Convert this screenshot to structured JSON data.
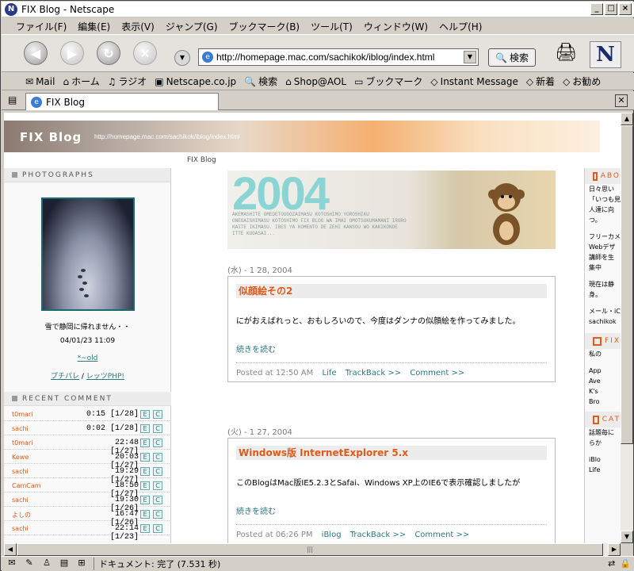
{
  "window": {
    "title": "FIX Blog - Netscape"
  },
  "menu": [
    "ファイル(F)",
    "編集(E)",
    "表示(V)",
    "ジャンプ(G)",
    "ブックマーク(B)",
    "ツール(T)",
    "ウィンドウ(W)",
    "ヘルプ(H)"
  ],
  "toolbar": {
    "url": "http://homepage.mac.com/sachikok/iblog/index.html",
    "search_label": "検索"
  },
  "personal_bar": [
    "Mail",
    "ホーム",
    "ラジオ",
    "Netscape.co.jp",
    "検索",
    "Shop@AOL",
    "ブックマーク",
    "Instant Message",
    "新着",
    "お勧め"
  ],
  "tab": {
    "label": "FIX Blog"
  },
  "status": {
    "text": "ドキュメント: 完了 (7.531 秒)"
  },
  "page": {
    "banner_title": "FIX Blog",
    "banner_url": "http://homepage.mac.com/sachikok/iblog/index.html",
    "crumb": "FIX Blog",
    "photos_header": "PHOTOGRAPHS",
    "photo_caption": "雪で静岡に帰れません・・",
    "photo_date": "04/01/23 11:09",
    "photo_link": "*~old",
    "links": [
      "プチパレ",
      "レッツPHP!"
    ],
    "recent_header": "RECENT COMMENT",
    "recent_comments": [
      {
        "name": "t0mari",
        "time": "0:15 [1/28]"
      },
      {
        "name": "sachi",
        "time": "0:02 [1/28]"
      },
      {
        "name": "t0mari",
        "time": "22:48 [1/27]"
      },
      {
        "name": "Kewe",
        "time": "20:03 [1/27]"
      },
      {
        "name": "sachi",
        "time": "19:29 [1/27]"
      },
      {
        "name": "CamCam",
        "time": "18:50 [1/27]"
      },
      {
        "name": "sachi",
        "time": "19:30 [1/26]"
      },
      {
        "name": "よしの",
        "time": "16:47 [1/26]"
      },
      {
        "name": "sachi",
        "time": "22:14 [1/23]"
      }
    ],
    "header_image": {
      "year": "2004",
      "text": "AKEMASHITE OMEDETOUGOZAIMASU KOTOSHIMO YOROSHIKU ONEGAISHIMASU KOTOSHIMO FIX BLOG WA IMAI OMOTSUKUMAMANI IRORO KAITE IKIMASU. IBES YA KOMENTO DE ZEHI KANSOU WO KAKIKONDE ITTE KUDASAI..."
    },
    "posts": [
      {
        "date": "(水) - 1 28, 2004",
        "title": "似顔絵その2",
        "body": "にがおえばれっと、おもしろいので、今度はダンナの似顔絵を作ってみました。",
        "more": "続きを読む",
        "posted": "Posted at 12:50 AM",
        "category": "Life",
        "trackback": "TrackBack >>",
        "comment": "Comment >>"
      },
      {
        "date": "(火) - 1 27, 2004",
        "title": "Windows版 InternetExplorer 5.x",
        "body": "このBlogはMac版IE5.2.3とSafai、Windows XP上のIE6で表示確認しましたが",
        "more": "続きを読む",
        "posted": "Posted at 06:26 PM",
        "category": "iBlog",
        "trackback": "TrackBack >>",
        "comment": "Comment >>"
      }
    ],
    "right": {
      "about_header": "ABO",
      "about_lines": [
        "日々思い",
        "「いつも見",
        "人達に向",
        "つ。",
        "",
        "フリーカメ",
        "Webデザ",
        "講師を生",
        "集中",
        "",
        "現在は静",
        "身。",
        "",
        "メール・iC",
        "sachikok"
      ],
      "fix_header": "FIX",
      "fix_lines": [
        "私の",
        "",
        "App",
        "Ave",
        "K's",
        "Bro"
      ],
      "cat_header": "CAT",
      "cat_lines": [
        "話題毎に",
        "らか",
        "",
        "iBlo",
        "Life"
      ]
    }
  }
}
